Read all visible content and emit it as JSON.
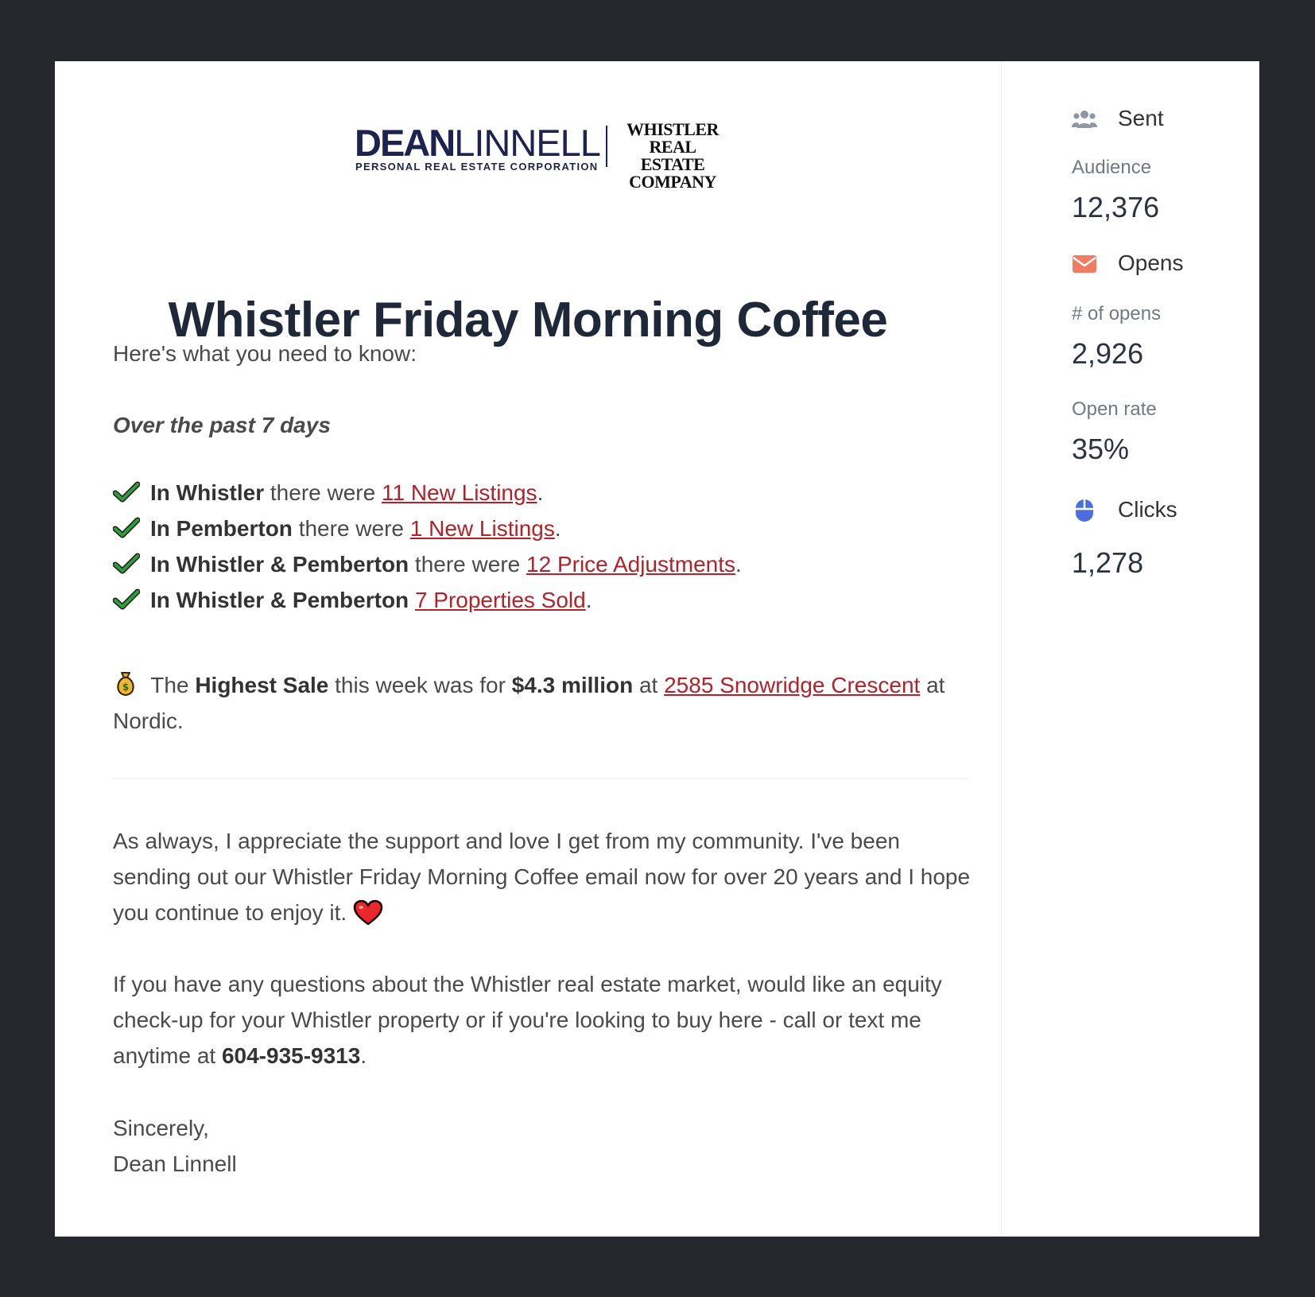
{
  "logo": {
    "name_bold": "DEAN",
    "name_light": "LINNELL",
    "tagline": "PERSONAL REAL ESTATE CORPORATION",
    "company_line1": "WHISTLER",
    "company_line2": "REAL ESTATE",
    "company_line3": "COMPANY"
  },
  "email": {
    "title": "Whistler Friday Morning Coffee",
    "intro": "Here's what you need to know:",
    "period": "Over the past 7 days",
    "items": [
      {
        "bold": "In Whistler",
        "mid": " there were ",
        "link": "11 New Listings",
        "end": "."
      },
      {
        "bold": "In Pemberton",
        "mid": " there were ",
        "link": "1 New Listings",
        "end": "."
      },
      {
        "bold": "In Whistler & Pemberton",
        "mid": " there were ",
        "link": "12 Price Adjustments",
        "end": "."
      },
      {
        "bold": "In Whistler & Pemberton",
        "mid": " ",
        "link": "7 Properties Sold",
        "end": "."
      }
    ],
    "highest": {
      "pre": " The ",
      "bold1": "Highest Sale",
      "mid": " this week was for ",
      "bold2": "$4.3 million",
      "at": " at ",
      "link": "2585 Snowridge Crescent",
      "end": " at Nordic."
    },
    "para1": "As always, I appreciate the support and love I get from my community. I've been sending out our Whistler Friday Morning Coffee email now for over 20 years and I hope you continue to enjoy it.",
    "para2_pre": "If you have any questions about the Whistler real estate market, would like an equity check-up for your Whistler property or if you're looking to buy here - call or text me anytime at ",
    "para2_phone": "604-935-9313",
    "para2_end": ".",
    "signoff": "Sincerely,",
    "signature": "Dean Linnell"
  },
  "stats": {
    "sent_label": "Sent",
    "audience_label": "Audience",
    "audience_value": "12,376",
    "opens_label": "Opens",
    "num_opens_label": "# of opens",
    "num_opens_value": "2,926",
    "open_rate_label": "Open rate",
    "open_rate_value": "35%",
    "clicks_label": "Clicks",
    "clicks_value": "1,278"
  },
  "icons": {
    "sent": "people-icon",
    "opens": "envelope-icon",
    "clicks": "mouse-icon",
    "check": "checkmark-icon",
    "money": "money-bag-icon",
    "heart": "heart-icon"
  },
  "colors": {
    "background": "#25272c",
    "link": "#b32229",
    "title": "#1e2838",
    "check": "#2e9e3a",
    "envelope": "#f07c62",
    "mouse": "#4a6ee0",
    "people": "#8f97a3"
  }
}
